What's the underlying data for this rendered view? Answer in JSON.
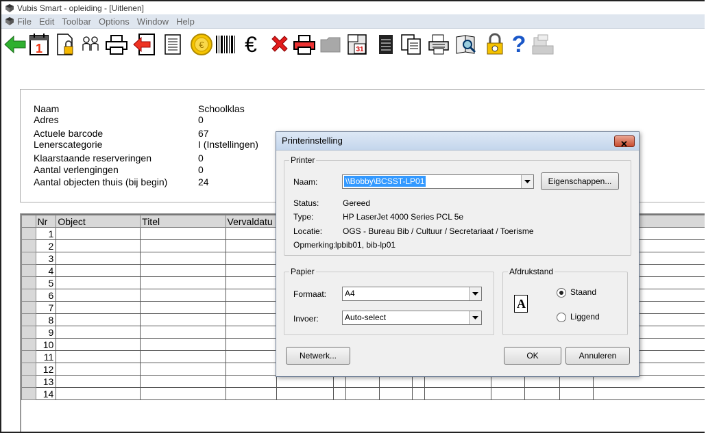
{
  "window": {
    "title": "Vubis Smart - opleiding - [Uitlenen]"
  },
  "menu": [
    "File",
    "Edit",
    "Toolbar",
    "Options",
    "Window",
    "Help"
  ],
  "toolbar": {
    "icons": [
      "back-arrow-icon",
      "calendar-icon",
      "document-lock-icon",
      "users-icon",
      "printer-icon",
      "exit-icon",
      "list-icon",
      "coin-icon",
      "barcode-icon",
      "euro-icon",
      "delete-icon",
      "printer-color-icon",
      "folder-icon",
      "calendar-may-icon",
      "book-icon",
      "copy-document-icon",
      "keyboard-printer-icon",
      "search-book-icon",
      "lock-gear-icon",
      "help-icon",
      "printer-gray-icon"
    ],
    "calendar_day": "1",
    "euro_symbol": "€",
    "help_symbol": "?"
  },
  "info": {
    "rows": [
      {
        "label": "Naam",
        "value": "Schoolklas"
      },
      {
        "label": "Adres",
        "value": "0"
      },
      {
        "label": "Actuele barcode",
        "value": "67"
      },
      {
        "label": "Lenerscategorie",
        "value": "I (Instellingen)"
      },
      {
        "label": "Klaarstaande reserveringen",
        "value": "0"
      },
      {
        "label": "Aantal verlengingen",
        "value": "0"
      },
      {
        "label": "Aantal objecten thuis (bij begin)",
        "value": "24"
      }
    ]
  },
  "grid": {
    "headers": [
      "Nr",
      "Object",
      "Titel",
      "Vervaldatu",
      "",
      "",
      "",
      "",
      "",
      "",
      "",
      ""
    ],
    "rows": [
      "1",
      "2",
      "3",
      "4",
      "5",
      "6",
      "7",
      "8",
      "9",
      "10",
      "11",
      "12",
      "13",
      "14"
    ]
  },
  "dialog": {
    "title": "Printerinstelling",
    "close_symbol": "✕",
    "printer_group": "Printer",
    "naam_label": "Naam:",
    "naam_value": "\\\\Bobby\\BCSST-LP01",
    "properties_button": "Eigenschappen...",
    "status_label": "Status:",
    "status_value": "Gereed",
    "type_label": "Type:",
    "type_value": "HP LaserJet 4000 Series PCL 5e",
    "locatie_label": "Locatie:",
    "locatie_value": "OGS - Bureau Bib / Cultuur / Secretariaat / Toerisme",
    "opmerking_label": "Opmerking:",
    "opmerking_value": "lpbib01, bib-lp01",
    "paper_group": "Papier",
    "formaat_label": "Formaat:",
    "formaat_value": "A4",
    "invoer_label": "Invoer:",
    "invoer_value": "Auto-select",
    "orientation_group": "Afdrukstand",
    "orientation_glyph": "A",
    "staand_label": "Staand",
    "liggend_label": "Liggend",
    "orientation_selected": "Staand",
    "netwerk_button": "Netwerk...",
    "ok_button": "OK",
    "cancel_button": "Annuleren"
  }
}
